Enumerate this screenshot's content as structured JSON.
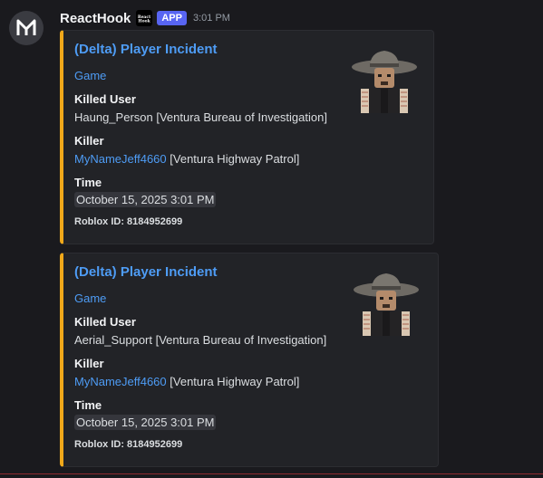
{
  "message": {
    "author": "ReactHook",
    "bot_icon_text": "ReactHook",
    "app_badge": "APP",
    "timestamp": "3:01 PM"
  },
  "embeds": [
    {
      "title": "(Delta) Player Incident",
      "link": "Game",
      "fields": [
        {
          "name": "Killed User",
          "value": "Haung_Person [Ventura Bureau of Investigation]"
        },
        {
          "name": "Killer",
          "link": "MyNameJeff4660",
          "value": " [Ventura Highway Patrol]"
        },
        {
          "name": "Time",
          "value": "October 15, 2025 3:01 PM"
        }
      ],
      "footer": "Roblox ID: 8184952699",
      "thumbnail_icon": "roblox-avatar-cowboy-hat-icon"
    },
    {
      "title": "(Delta) Player Incident",
      "link": "Game",
      "fields": [
        {
          "name": "Killed User",
          "value": "Aerial_Support [Ventura Bureau of Investigation]"
        },
        {
          "name": "Killer",
          "link": "MyNameJeff4660",
          "value": " [Ventura Highway Patrol]"
        },
        {
          "name": "Time",
          "value": "October 15, 2025 3:01 PM"
        }
      ],
      "footer": "Roblox ID: 8184952699",
      "thumbnail_icon": "roblox-avatar-cowboy-hat-icon"
    }
  ],
  "colors": {
    "background": "#1a1a1e",
    "embed_background": "#222327",
    "embed_accent": "#f0a81a",
    "link": "#4e9cf5",
    "app_badge": "#5865f2"
  }
}
